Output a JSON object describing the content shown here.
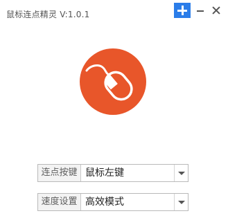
{
  "app": {
    "title": "鼠标连点精灵 V:1.0.1"
  },
  "window_controls": [
    "plus-icon",
    "minimize-icon",
    "close-icon"
  ],
  "logo": {
    "icon": "mouse-icon",
    "color": "#e8562a"
  },
  "settings": {
    "click_key": {
      "label": "连点按键",
      "value": "鼠标左键"
    },
    "speed": {
      "label": "速度设置",
      "value": "高效模式"
    }
  }
}
